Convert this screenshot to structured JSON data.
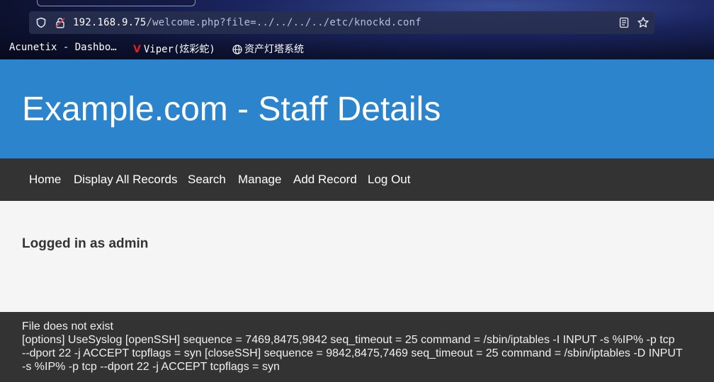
{
  "browser": {
    "url_host": "192.168.9.75",
    "url_path": "/welcome.php?file=../../../../etc/knockd.conf",
    "bookmarks": [
      {
        "label": "Acunetix - Dashbo…"
      },
      {
        "label": "Viper(炫彩蛇)",
        "icon_text": "V"
      },
      {
        "label": "资产灯塔系统"
      }
    ]
  },
  "header": {
    "title": "Example.com - Staff Details"
  },
  "nav": {
    "items": [
      {
        "label": "Home"
      },
      {
        "label": "Display All Records"
      },
      {
        "label": "Search"
      },
      {
        "label": "Manage"
      },
      {
        "label": "Add Record"
      },
      {
        "label": "Log Out"
      }
    ]
  },
  "main": {
    "logged_in_text": "Logged in as admin"
  },
  "footer": {
    "lines": [
      "File does not exist",
      "[options] UseSyslog [openSSH] sequence = 7469,8475,9842 seq_timeout = 25 command = /sbin/iptables -I INPUT -s %IP% -p tcp",
      "--dport 22 -j ACCEPT tcpflags = syn [closeSSH] sequence = 9842,8475,7469 seq_timeout = 25 command = /sbin/iptables -D INPUT",
      "-s %IP% -p tcp --dport 22 -j ACCEPT tcpflags = syn"
    ]
  },
  "colors": {
    "header_bg": "#2b84cc",
    "nav_bg": "#333333",
    "body_bg": "#f5f5f5",
    "viper_icon": "#e02020"
  }
}
